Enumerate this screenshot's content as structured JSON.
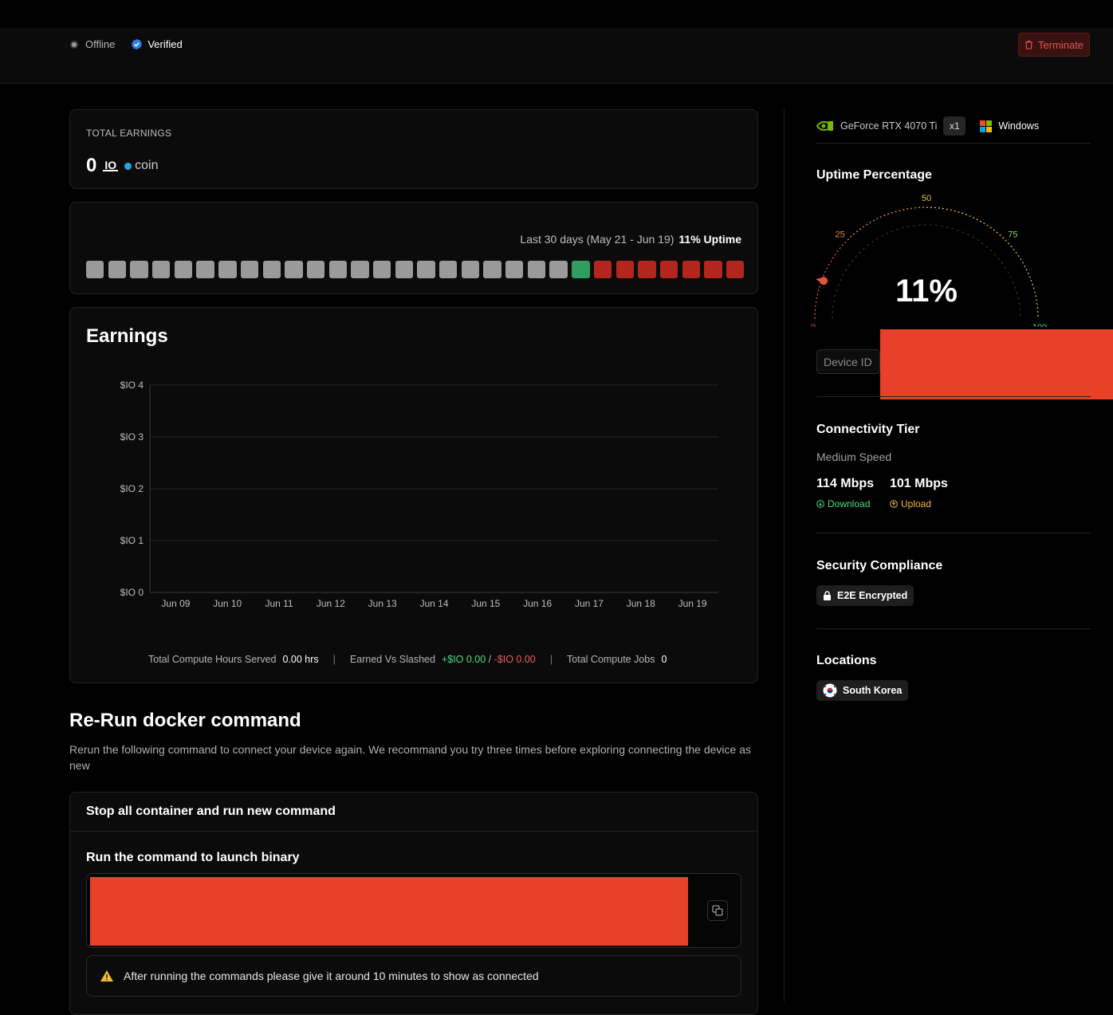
{
  "header": {
    "status_label": "Offline",
    "verified_label": "Verified",
    "terminate_label": "Terminate"
  },
  "earnings_card": {
    "label": "TOTAL EARNINGS",
    "value": "0",
    "io_mark": "IO",
    "coin_label": "coin"
  },
  "uptime_card": {
    "range_label": "Last 30 days (May 21 - Jun 19)",
    "uptime_label": "11% Uptime",
    "days": [
      "none",
      "none",
      "none",
      "none",
      "none",
      "none",
      "none",
      "none",
      "none",
      "none",
      "none",
      "none",
      "none",
      "none",
      "none",
      "none",
      "none",
      "none",
      "none",
      "none",
      "none",
      "none",
      "up",
      "down",
      "down",
      "down",
      "down",
      "down",
      "down",
      "down"
    ],
    "colors": {
      "none": "#9a9a9a",
      "up": "#2f9e5f",
      "down": "#b3261e"
    }
  },
  "earnings_chart": {
    "title": "Earnings",
    "chart_data": {
      "type": "line",
      "title": "Earnings",
      "xlabel": "",
      "ylabel": "",
      "categories": [
        "Jun 09",
        "Jun 10",
        "Jun 11",
        "Jun 12",
        "Jun 13",
        "Jun 14",
        "Jun 15",
        "Jun 16",
        "Jun 17",
        "Jun 18",
        "Jun 19"
      ],
      "series": [
        {
          "values": [
            0,
            0,
            0,
            0,
            0,
            0,
            0,
            0,
            0,
            0,
            0
          ]
        }
      ],
      "yticks": [
        "$IO 0",
        "$IO 1",
        "$IO 2",
        "$IO 3",
        "$IO 4"
      ],
      "ylim": [
        0,
        4
      ],
      "grid": true
    },
    "stats": {
      "hours_label": "Total Compute Hours Served",
      "hours_value": "0.00 hrs",
      "earned_label": "Earned Vs Slashed",
      "earned_value": "+$IO 0.00",
      "slash_sep": "/",
      "slashed_value": "-$IO 0.00",
      "jobs_label": "Total Compute Jobs",
      "jobs_value": "0",
      "separator": "|"
    }
  },
  "rerun": {
    "title": "Re-Run docker command",
    "description": "Rerun the following command to connect your device again. We recommand you try three times before exploring connecting the device as new",
    "card_title": "Stop all container and run new command",
    "sub_title": "Run the command to launch binary",
    "warning": "After running the commands please give it around 10 minutes to show as connected"
  },
  "sidebar": {
    "gpu_name": "GeForce RTX 4070 Ti",
    "gpu_count": "x1",
    "os": "Windows",
    "uptime_title": "Uptime Percentage",
    "uptime_value": "11%",
    "uptime_percent": 11,
    "gauge_labels": [
      "0",
      "25",
      "50",
      "75",
      "100"
    ],
    "device_id_label": "Device ID",
    "connectivity_title": "Connectivity Tier",
    "connectivity_tier": "Medium Speed",
    "download_speed": "114 Mbps",
    "download_label": "Download",
    "upload_speed": "101 Mbps",
    "upload_label": "Upload",
    "security_title": "Security Compliance",
    "security_badge": "E2E Encrypted",
    "locations_title": "Locations",
    "location": "South Korea"
  }
}
